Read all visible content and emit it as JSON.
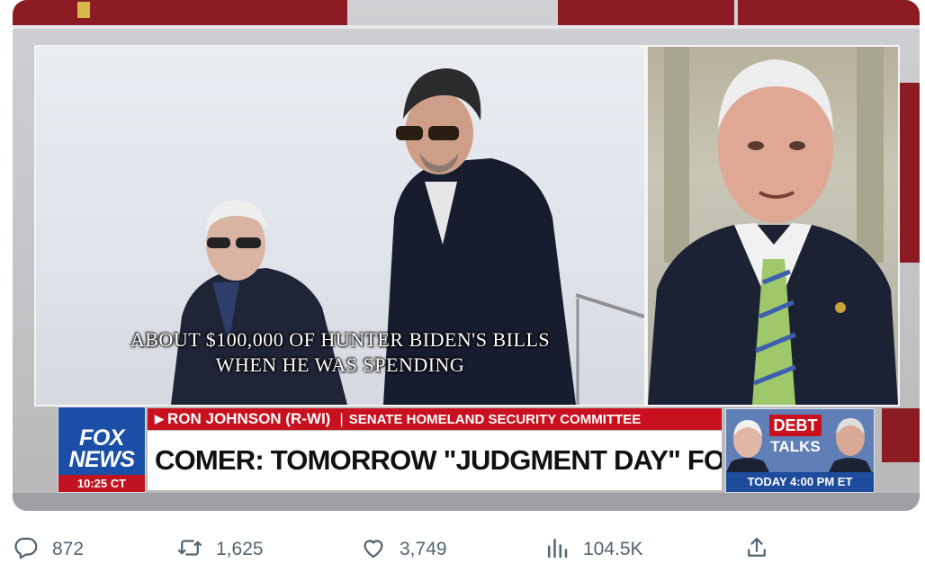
{
  "video": {
    "caption_line1": "ABOUT $100,000 OF HUNTER BIDEN'S BILLS",
    "caption_line2": "WHEN HE WAS SPENDING",
    "network_logo_top": "FOX",
    "network_logo_bottom": "NEWS",
    "time": "10:25 CT",
    "speaker_name": "RON JOHNSON (R-WI)",
    "separator": "|",
    "speaker_role": "SENATE HOMELAND SECURITY COMMITTEE",
    "headline": "COMER: TOMORROW \"JUDGMENT DAY\" FOR THE BIDENS",
    "promo_title_1": "DEBT",
    "promo_title_2": "TALKS",
    "promo_time": "TODAY 4:00 PM ET"
  },
  "actions": {
    "reply": {
      "icon": "reply-icon",
      "count": "872"
    },
    "retweet": {
      "icon": "retweet-icon",
      "count": "1,625"
    },
    "like": {
      "icon": "heart-icon",
      "count": "3,749"
    },
    "views": {
      "icon": "views-icon",
      "count": "104.5K"
    },
    "share": {
      "icon": "share-icon"
    }
  },
  "colors": {
    "fox_red": "#c8101e",
    "fox_blue": "#1b4fa7",
    "icon_gray": "#536471"
  }
}
